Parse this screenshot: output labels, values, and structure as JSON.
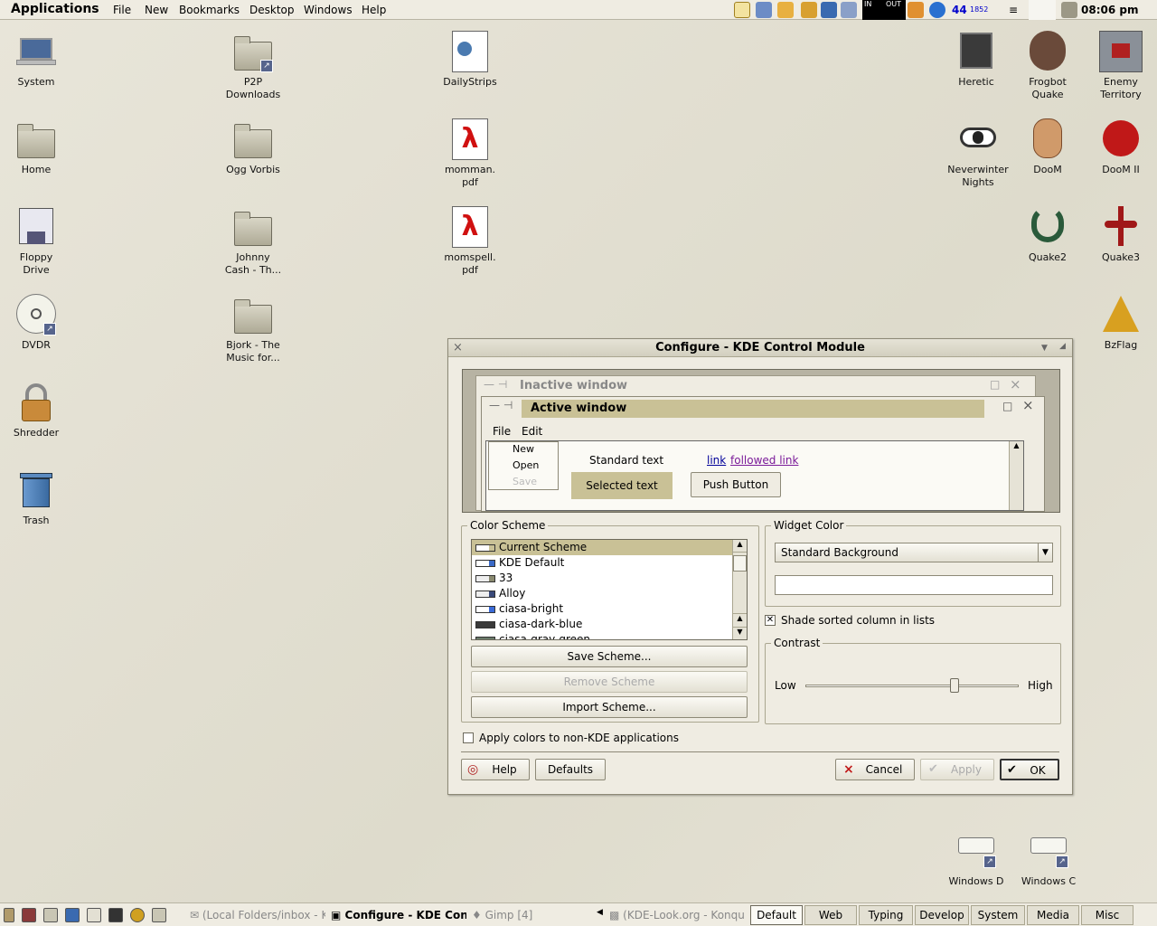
{
  "top_panel": {
    "applications": "Applications",
    "menus": [
      "File",
      "New",
      "Bookmarks",
      "Desktop",
      "Windows",
      "Help"
    ],
    "net_in": "IN",
    "net_out": "OUT",
    "counter": "44",
    "small_count": "1852",
    "clock": "08:06 pm"
  },
  "desktop_icons": {
    "system": "System",
    "p2p_1": "P2P",
    "p2p_2": "Downloads",
    "dailystrips": "DailyStrips",
    "home": "Home",
    "ogg": "Ogg Vorbis",
    "momman_1": "momman.",
    "momman_2": "pdf",
    "floppy_1": "Floppy",
    "floppy_2": "Drive",
    "johnny_1": "Johnny",
    "johnny_2": "Cash - Th...",
    "momspell_1": "momspell.",
    "momspell_2": "pdf",
    "dvdr": "DVDR",
    "bjork_1": "Bjork - The",
    "bjork_2": "Music for...",
    "shredder": "Shredder",
    "trash": "Trash",
    "heretic": "Heretic",
    "frogbot_1": "Frogbot",
    "frogbot_2": "Quake",
    "enemy_1": "Enemy",
    "enemy_2": "Territory",
    "nwn_1": "Neverwinter",
    "nwn_2": "Nights",
    "doom": "DooM",
    "doom2": "DooM II",
    "quake2": "Quake2",
    "quake3": "Quake3",
    "bzflag": "BzFlag",
    "windows_d": "Windows D",
    "windows_c": "Windows C"
  },
  "dialog": {
    "title": "Configure - KDE Control Module",
    "preview": {
      "inactive_title": "Inactive window",
      "active_title": "Active window",
      "menu_file": "File",
      "menu_edit": "Edit",
      "popup_items": [
        "New",
        "Open",
        "Save"
      ],
      "standard_text": "Standard text",
      "selected_text": "Selected text",
      "link": "link",
      "followed_link": "followed link",
      "push_button": "Push Button"
    },
    "color_scheme": {
      "label": "Color Scheme",
      "items": [
        "Current Scheme",
        "KDE Default",
        "33",
        "Alloy",
        "ciasa-bright",
        "ciasa-dark-blue",
        "ciasa-gray-green"
      ],
      "save": "Save Scheme...",
      "remove": "Remove Scheme",
      "import": "Import Scheme..."
    },
    "widget_color": {
      "label": "Widget Color",
      "selected": "Standard Background"
    },
    "shade_sorted": "Shade sorted column in lists",
    "contrast": {
      "label": "Contrast",
      "low": "Low",
      "high": "High",
      "level": 0.7
    },
    "apply_non_kde": "Apply colors to non-KDE applications",
    "buttons": {
      "help": "Help",
      "defaults": "Defaults",
      "cancel": "Cancel",
      "apply": "Apply",
      "ok": "OK"
    }
  },
  "taskbar": {
    "tasks": [
      "(Local Folders/inbox - K",
      "Configure - KDE Con",
      "Gimp [4]",
      "(KDE-Look.org - Konqu"
    ],
    "desktops": [
      "Default",
      "Web",
      "Typing",
      "Develop",
      "System",
      "Media",
      "Misc"
    ]
  },
  "colors": {
    "selection": "#c9c196",
    "panel": "#efece2",
    "link": "#000099",
    "followed_link": "#7a1a99"
  }
}
